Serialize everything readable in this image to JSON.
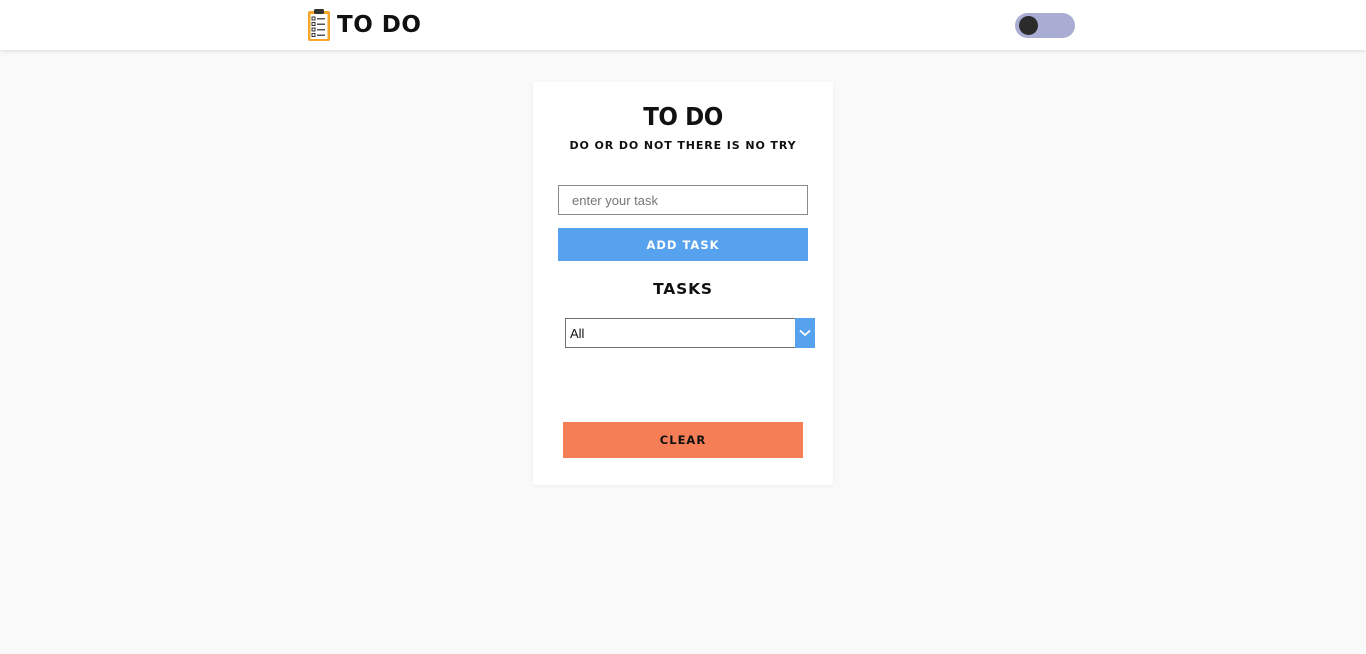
{
  "navbar": {
    "brand_text": "TO DO",
    "brand_icon": "clipboard-checklist-icon",
    "theme_toggle": {
      "state": "off",
      "track_color": "#a9acd3",
      "knob_color": "#2b2b2b"
    }
  },
  "card": {
    "title": "TO DO",
    "subtitle": "DO OR DO NOT THERE IS NO TRY",
    "task_input": {
      "value": "",
      "placeholder": "enter your task"
    },
    "add_button_label": "ADD TASK",
    "tasks_heading": "TASKS",
    "filter": {
      "selected": "All",
      "icon": "chevron-down-icon"
    },
    "tasks": [],
    "clear_button_label": "CLEAR"
  },
  "colors": {
    "background": "#f9f9f9",
    "accent_blue": "#57a2ef",
    "accent_orange": "#f57e57"
  }
}
